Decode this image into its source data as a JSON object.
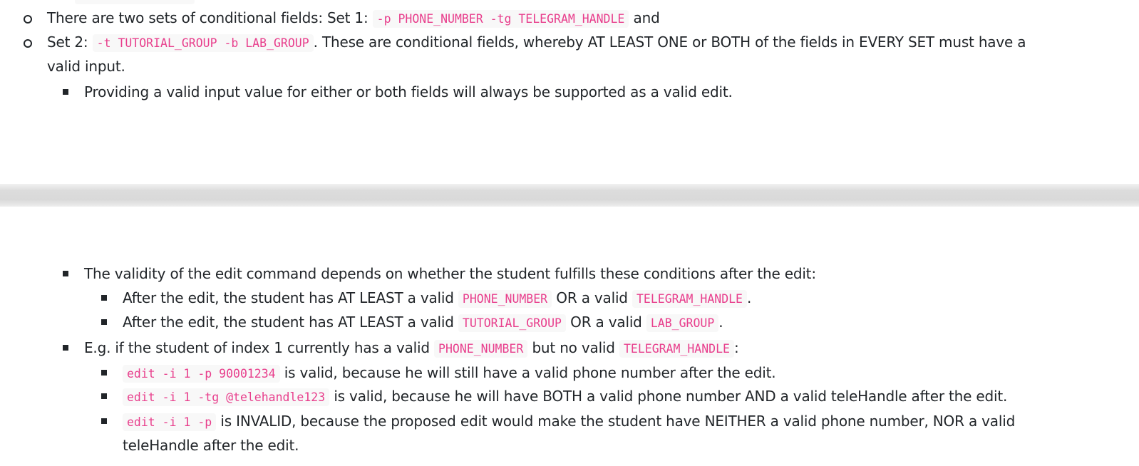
{
  "top": {
    "items": [
      {
        "pre": "There are two sets of conditional fields: Set 1:",
        "code": "-p PHONE_NUMBER -tg TELEGRAM_HANDLE",
        "post": "and"
      },
      {
        "pre": "Set 2:",
        "code": "-t TUTORIAL_GROUP -b LAB_GROUP",
        "post": ". These are conditional fields, whereby AT LEAST ONE or BOTH of the fields in EVERY SET must have a",
        "cont": "valid input."
      }
    ],
    "sub_item": "Providing a valid input value for either or both fields will always be supported as a valid edit."
  },
  "bottom": {
    "validity": {
      "text": "The validity of the edit command depends on whether the student fulfills these conditions after the edit:",
      "conditions": [
        {
          "pre": "After the edit, the student has AT LEAST a valid",
          "code1": "PHONE_NUMBER",
          "mid": "OR a valid",
          "code2": "TELEGRAM_HANDLE",
          "post": "."
        },
        {
          "pre": "After the edit, the student has AT LEAST a valid",
          "code1": "TUTORIAL_GROUP",
          "mid": "OR a valid",
          "code2": "LAB_GROUP",
          "post": "."
        }
      ]
    },
    "example": {
      "pre": "E.g. if the student of index 1 currently has a valid",
      "code1": "PHONE_NUMBER",
      "mid": "but no valid",
      "code2": "TELEGRAM_HANDLE",
      "post": ":",
      "cases": [
        {
          "code": "edit -i 1 -p 90001234",
          "text": "is valid, because he will still have a valid phone number after the edit."
        },
        {
          "code": "edit -i 1 -tg @telehandle123",
          "text": "is valid, because he will have BOTH a valid phone number AND a valid teleHandle after the edit."
        },
        {
          "code": "edit -i 1 -p",
          "text": "is INVALID, because the proposed edit would make the student have NEITHER a valid phone number, NOR a valid",
          "cont": "teleHandle after the edit."
        }
      ]
    }
  }
}
